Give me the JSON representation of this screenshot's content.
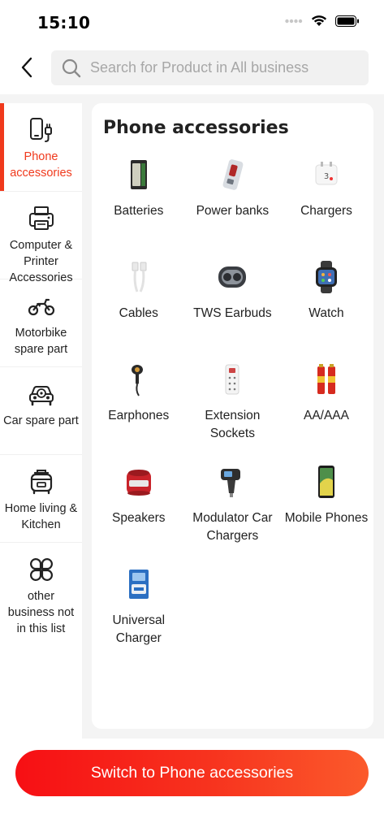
{
  "status_bar": {
    "time": "15:10"
  },
  "header": {
    "back_icon": "chevron-left-icon",
    "search_placeholder": "Search for Product in All business"
  },
  "sidebar": {
    "active_color": "#f0391c",
    "items": [
      {
        "label": "Phone accessories",
        "icon": "phone-charger-icon",
        "active": true
      },
      {
        "label": "Computer & Printer Accessories",
        "icon": "printer-icon",
        "active": false
      },
      {
        "label": "Motorbike spare part",
        "icon": "motorbike-icon",
        "active": false
      },
      {
        "label": "Car spare part",
        "icon": "car-icon",
        "active": false
      },
      {
        "label": "Home living & Kitchen",
        "icon": "cooker-icon",
        "active": false
      },
      {
        "label": "other business not in this list",
        "icon": "clover-icon",
        "active": false
      }
    ]
  },
  "content": {
    "title": "Phone accessories",
    "items": [
      {
        "label": "Batteries",
        "icon": "battery-image"
      },
      {
        "label": "Power banks",
        "icon": "powerbank-image"
      },
      {
        "label": "Chargers",
        "icon": "charger-image"
      },
      {
        "label": "Cables",
        "icon": "cable-image"
      },
      {
        "label": "TWS Earbuds",
        "icon": "earbuds-image"
      },
      {
        "label": "Watch",
        "icon": "watch-image"
      },
      {
        "label": "Earphones",
        "icon": "earphones-image"
      },
      {
        "label": "Extension Sockets",
        "icon": "extension-socket-image"
      },
      {
        "label": "AA/AAA",
        "icon": "aa-batteries-image"
      },
      {
        "label": "Speakers",
        "icon": "speaker-image"
      },
      {
        "label": "Modulator Car Chargers",
        "icon": "car-charger-image"
      },
      {
        "label": "Mobile Phones",
        "icon": "mobile-phone-image"
      },
      {
        "label": "Universal Charger",
        "icon": "universal-charger-image"
      }
    ]
  },
  "footer": {
    "cta_label": "Switch to Phone accessories"
  }
}
